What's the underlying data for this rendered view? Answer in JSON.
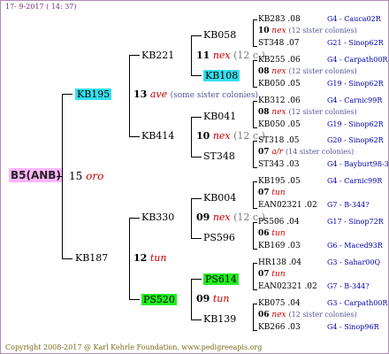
{
  "header": "17-  9-2017 ( 14: 37)",
  "footer": "Copyright 2008-2017 @ Karl Kehrle Foundation.   www.pedigreeapis.org",
  "root": {
    "code": "B5(ANB)",
    "year": "15",
    "breeder": "oro"
  },
  "gen1": [
    {
      "code": "KB195",
      "year": "13",
      "breeder": "ave",
      "note": "(some sister colonies)"
    },
    {
      "code": "KB187",
      "year": "12",
      "breeder": "tun"
    }
  ],
  "gen2": [
    {
      "code": "KB221",
      "year": "11",
      "breeder": "nex",
      "note": "(12 c.)"
    },
    {
      "code": "KB414",
      "year": "10",
      "breeder": "nex",
      "note": "(12 c.)"
    },
    {
      "code": "KB330",
      "year": "09",
      "breeder": "nex",
      "note": "(12 c.)"
    },
    {
      "code": "PS520",
      "year": "09",
      "breeder": "tun"
    }
  ],
  "gen3": [
    {
      "code": "KB058"
    },
    {
      "code": "KB108"
    },
    {
      "code": "KB041"
    },
    {
      "code": "ST348"
    },
    {
      "code": "KB004"
    },
    {
      "code": "PS596"
    },
    {
      "code": "PS614"
    },
    {
      "code": "KB139"
    }
  ],
  "gen4": [
    {
      "a": "KB283 .08",
      "ar": "G4 - Cauca02R",
      "m_year": "10",
      "m_br": "nex",
      "m_note": "(12 sister colonies)",
      "b": "ST348 .07",
      "br": "G21 - Sinop62R"
    },
    {
      "a": "KB255 .06",
      "ar": "G4 - Carpath00R",
      "m_year": "08",
      "m_br": "nex",
      "m_note": "(12 sister colonies)",
      "b": "KB050 .05",
      "br": "G19 - Sinop62R"
    },
    {
      "a": "KB312 .06",
      "ar": "G4 - Carnic99R",
      "m_year": "08",
      "m_br": "nex",
      "m_note": "(12 sister colonies)",
      "b": "KB050 .05",
      "br": "G19 - Sinop62R"
    },
    {
      "a": "ST318 .05",
      "ar": "G20 - Sinop62R",
      "m_year": "07",
      "m_br": "a/r",
      "m_note": "(14 sister colonies)",
      "b": "ST343 .03",
      "br": "G4 - Bayburt98-3"
    },
    {
      "a": "KB195 .05",
      "ar": "G4 - Carnic99R",
      "m_year": "07",
      "m_br": "tun",
      "m_note": "",
      "b": "EAN02321 .02",
      "br": "G7 - B-344?"
    },
    {
      "a": "PS506 .04",
      "ar": "G17 - Sinop72R",
      "m_year": "06",
      "m_br": "tun",
      "m_note": "",
      "b": "KB169 .03",
      "br": "G6 - Maced93R"
    },
    {
      "a": "HR138 .04",
      "ar": "G3 - Sahar00Q",
      "m_year": "07",
      "m_br": "tun",
      "m_note": "",
      "b": "EAN02321 .02",
      "br": "G7 - B-344?"
    },
    {
      "a": "KB075 .04",
      "ar": "G3 - Carpath00R",
      "m_year": "06",
      "m_br": "nex",
      "m_note": "(12 sister colonies)",
      "b": "KB266 .03",
      "br": "G4 - Sinop96R"
    }
  ]
}
